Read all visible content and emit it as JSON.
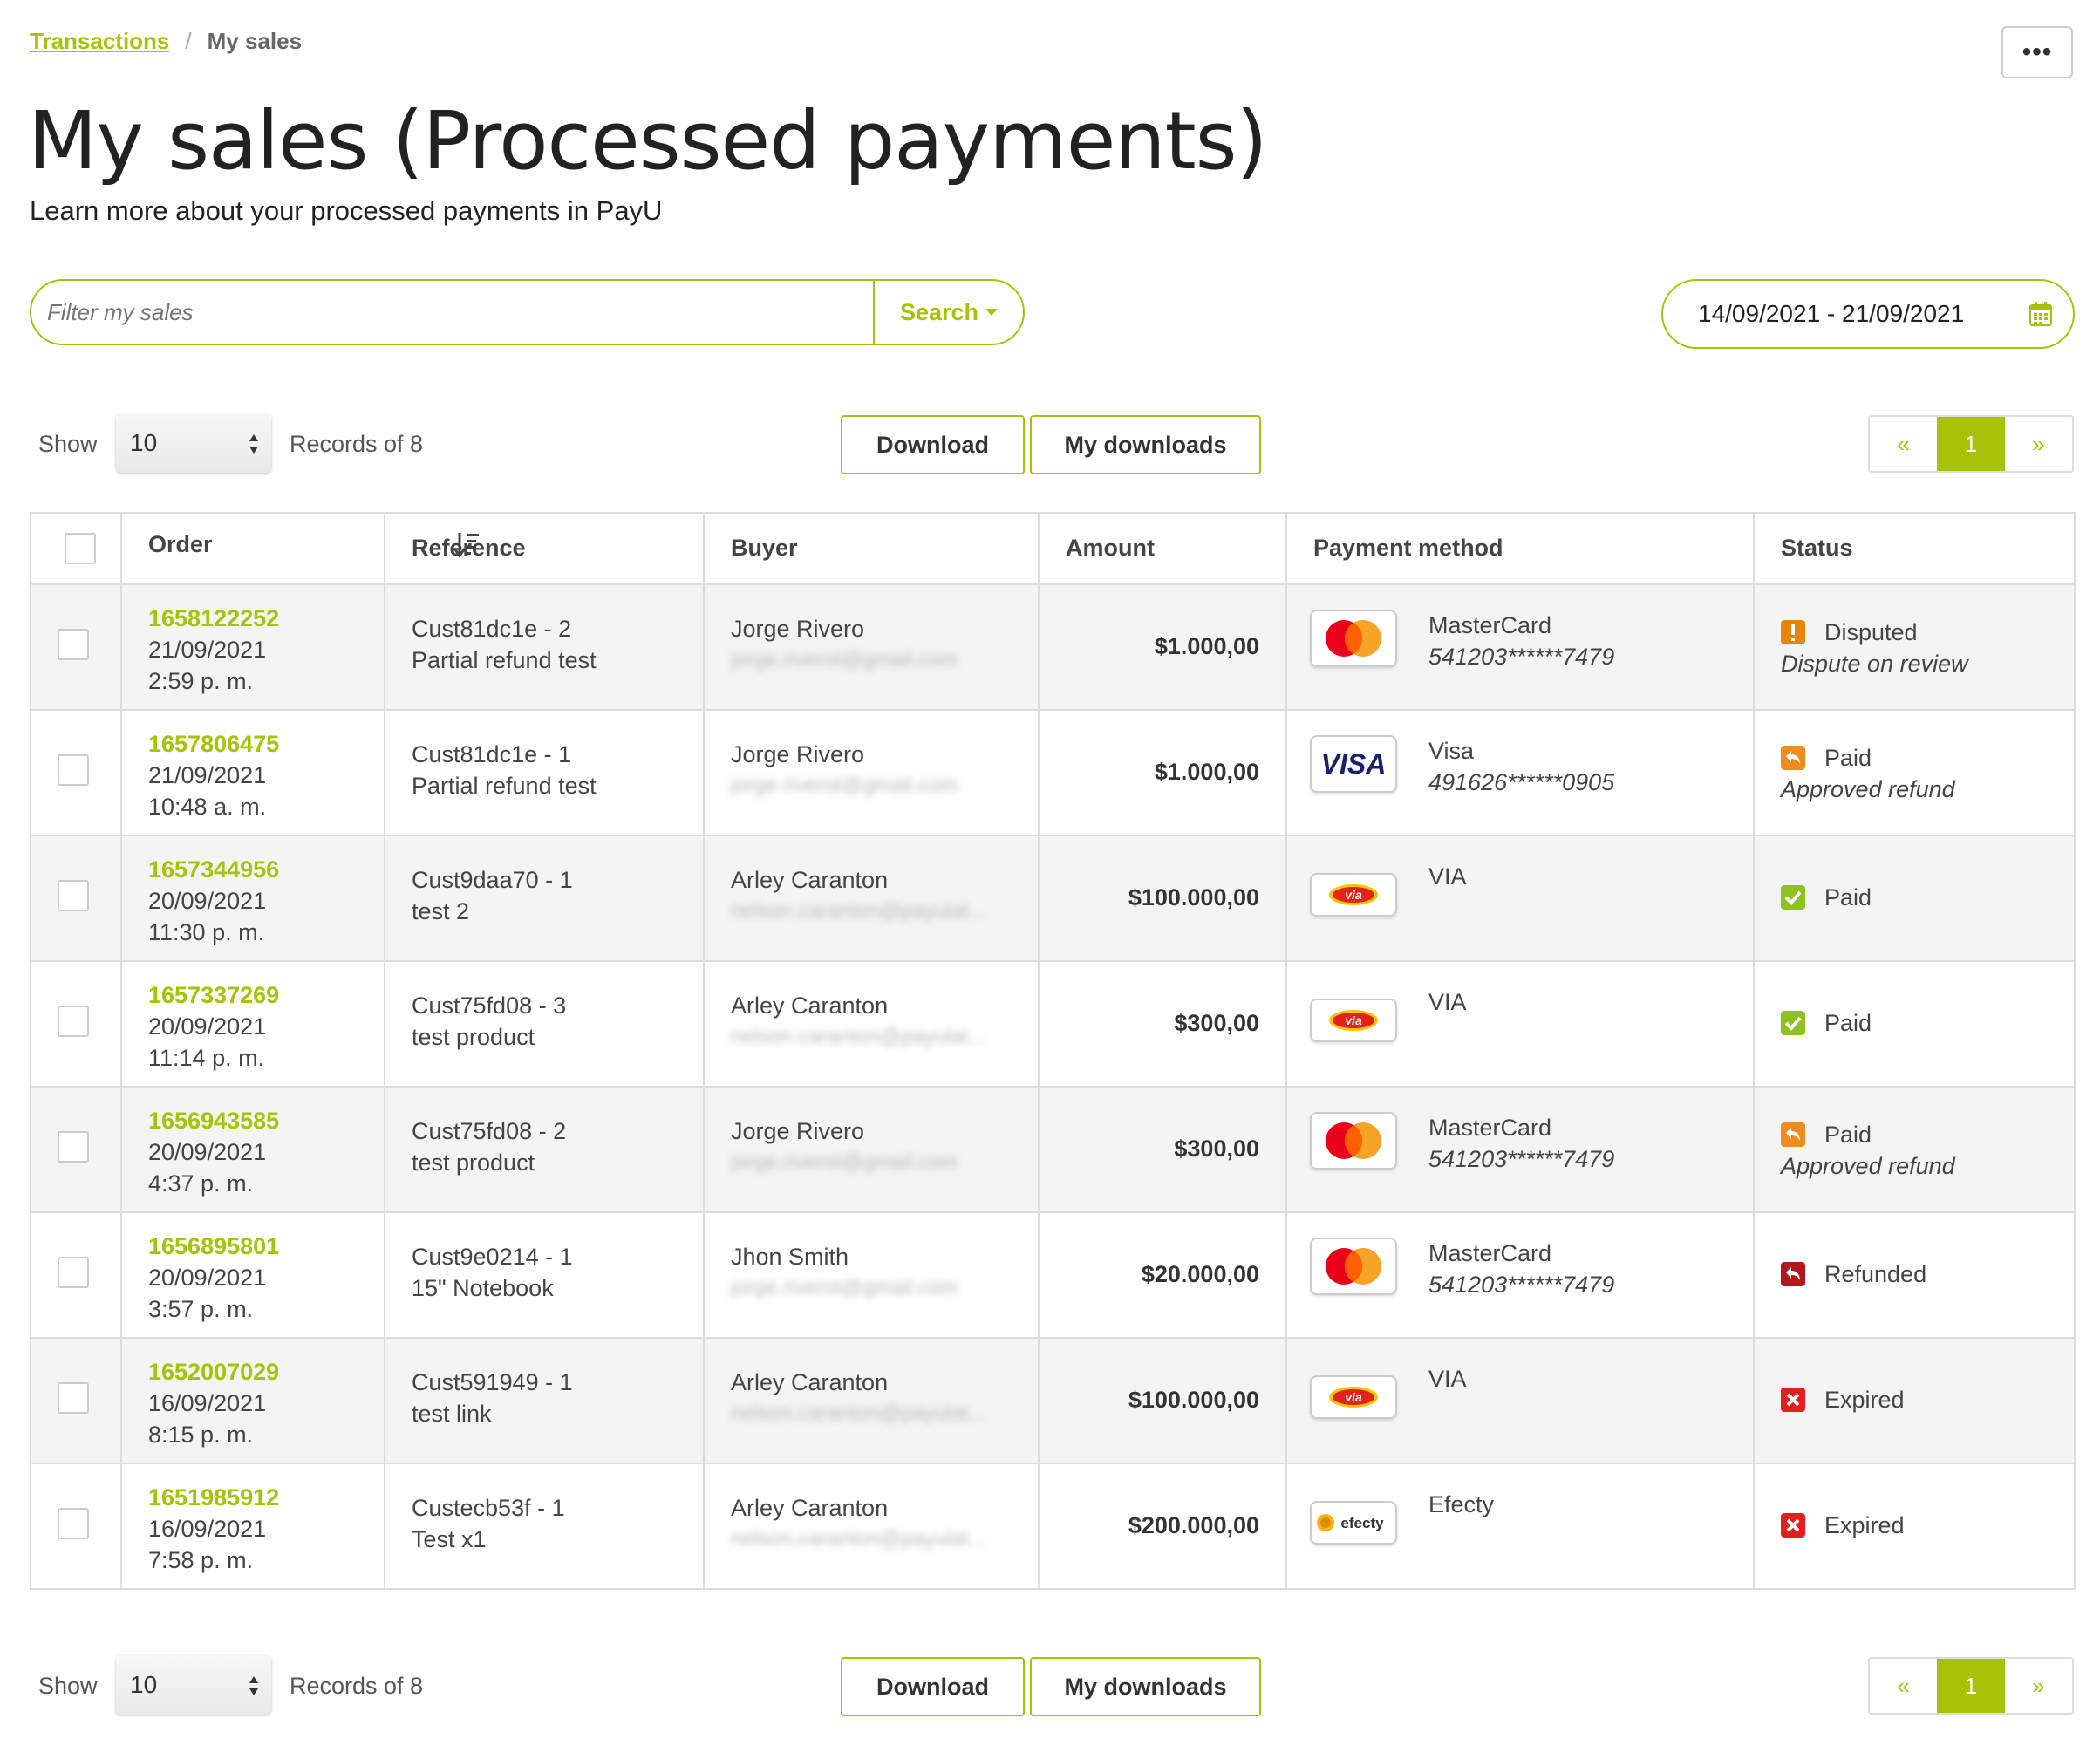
{
  "breadcrumb": {
    "link": "Transactions",
    "separator": "/",
    "current": "My sales"
  },
  "header": {
    "more_label": "•••",
    "title": "My sales (Processed payments)",
    "subtitle": "Learn more about your processed payments in PayU"
  },
  "filter": {
    "placeholder": "Filter my sales",
    "search_label": "Search"
  },
  "date_range": {
    "value": "14/09/2021 - 21/09/2021"
  },
  "toolbar": {
    "show_label": "Show",
    "show_value": "10",
    "records_label": "Records of 8",
    "download_label": "Download",
    "my_downloads_label": "My downloads",
    "pager_prev": "«",
    "pager_current": "1",
    "pager_next": "»"
  },
  "columns": [
    "Order",
    "Reference",
    "Buyer",
    "Amount",
    "Payment method",
    "Status"
  ],
  "rows": [
    {
      "order": "1658122252",
      "date": "21/09/2021",
      "time": "2:59 p. m.",
      "ref1": "Cust81dc1e - 2",
      "ref2": "Partial refund test",
      "buyer": "Jorge Rivero",
      "email": "jorge.riverot@gmail.com",
      "amount": "$1.000,00",
      "pm_icon": "mastercard-logo",
      "pm": "MasterCard",
      "pm_number": "541203******7479",
      "status_icon": "disputed-icon",
      "status": "Disputed",
      "status_sub": "Dispute on review"
    },
    {
      "order": "1657806475",
      "date": "21/09/2021",
      "time": "10:48 a. m.",
      "ref1": "Cust81dc1e - 1",
      "ref2": "Partial refund test",
      "buyer": "Jorge Rivero",
      "email": "jorge.riverot@gmail.com",
      "amount": "$1.000,00",
      "pm_icon": "visa-logo",
      "pm": "Visa",
      "pm_number": "491626******0905",
      "status_icon": "refund-icon",
      "status": "Paid",
      "status_sub": "Approved refund"
    },
    {
      "order": "1657344956",
      "date": "20/09/2021",
      "time": "11:30 p. m.",
      "ref1": "Cust9daa70 - 1",
      "ref2": "test 2",
      "buyer": "Arley Caranton",
      "email": "nelson.caranton@payulat...",
      "amount": "$100.000,00",
      "pm_icon": "via-logo",
      "pm": "VIA",
      "pm_number": "",
      "status_icon": "check-icon",
      "status": "Paid",
      "status_sub": ""
    },
    {
      "order": "1657337269",
      "date": "20/09/2021",
      "time": "11:14 p. m.",
      "ref1": "Cust75fd08 - 3",
      "ref2": "test product",
      "buyer": "Arley Caranton",
      "email": "nelson.caranton@payulat...",
      "amount": "$300,00",
      "pm_icon": "via-logo",
      "pm": "VIA",
      "pm_number": "",
      "status_icon": "check-icon",
      "status": "Paid",
      "status_sub": ""
    },
    {
      "order": "1656943585",
      "date": "20/09/2021",
      "time": "4:37 p. m.",
      "ref1": "Cust75fd08 - 2",
      "ref2": "test product",
      "buyer": "Jorge Rivero",
      "email": "jorge.riverot@gmail.com",
      "amount": "$300,00",
      "pm_icon": "mastercard-logo",
      "pm": "MasterCard",
      "pm_number": "541203******7479",
      "status_icon": "refund-icon",
      "status": "Paid",
      "status_sub": "Approved refund"
    },
    {
      "order": "1656895801",
      "date": "20/09/2021",
      "time": "3:57 p. m.",
      "ref1": "Cust9e0214 - 1",
      "ref2": "15\" Notebook",
      "buyer": "Jhon Smith",
      "email": "jorge.riverot@gmail.com",
      "amount": "$20.000,00",
      "pm_icon": "mastercard-logo",
      "pm": "MasterCard",
      "pm_number": "541203******7479",
      "status_icon": "refunded-icon",
      "status": "Refunded",
      "status_sub": ""
    },
    {
      "order": "1652007029",
      "date": "16/09/2021",
      "time": "8:15 p. m.",
      "ref1": "Cust591949 - 1",
      "ref2": "test link",
      "buyer": "Arley Caranton",
      "email": "nelson.caranton@payulat...",
      "amount": "$100.000,00",
      "pm_icon": "via-logo",
      "pm": "VIA",
      "pm_number": "",
      "status_icon": "expired-icon",
      "status": "Expired",
      "status_sub": ""
    },
    {
      "order": "1651985912",
      "date": "16/09/2021",
      "time": "7:58 p. m.",
      "ref1": "Custecb53f - 1",
      "ref2": "Test x1",
      "buyer": "Arley Caranton",
      "email": "nelson.caranton@payulat...",
      "amount": "$200.000,00",
      "pm_icon": "efecty-logo",
      "pm": "Efecty",
      "pm_number": "",
      "status_icon": "expired-icon",
      "status": "Expired",
      "status_sub": ""
    }
  ],
  "colors": {
    "accent": "#a6c307",
    "disputed": "#e8840c",
    "refund": "#f08c1e",
    "paid": "#8ec21f",
    "refunded": "#b0181c",
    "expired": "#e0201f"
  }
}
